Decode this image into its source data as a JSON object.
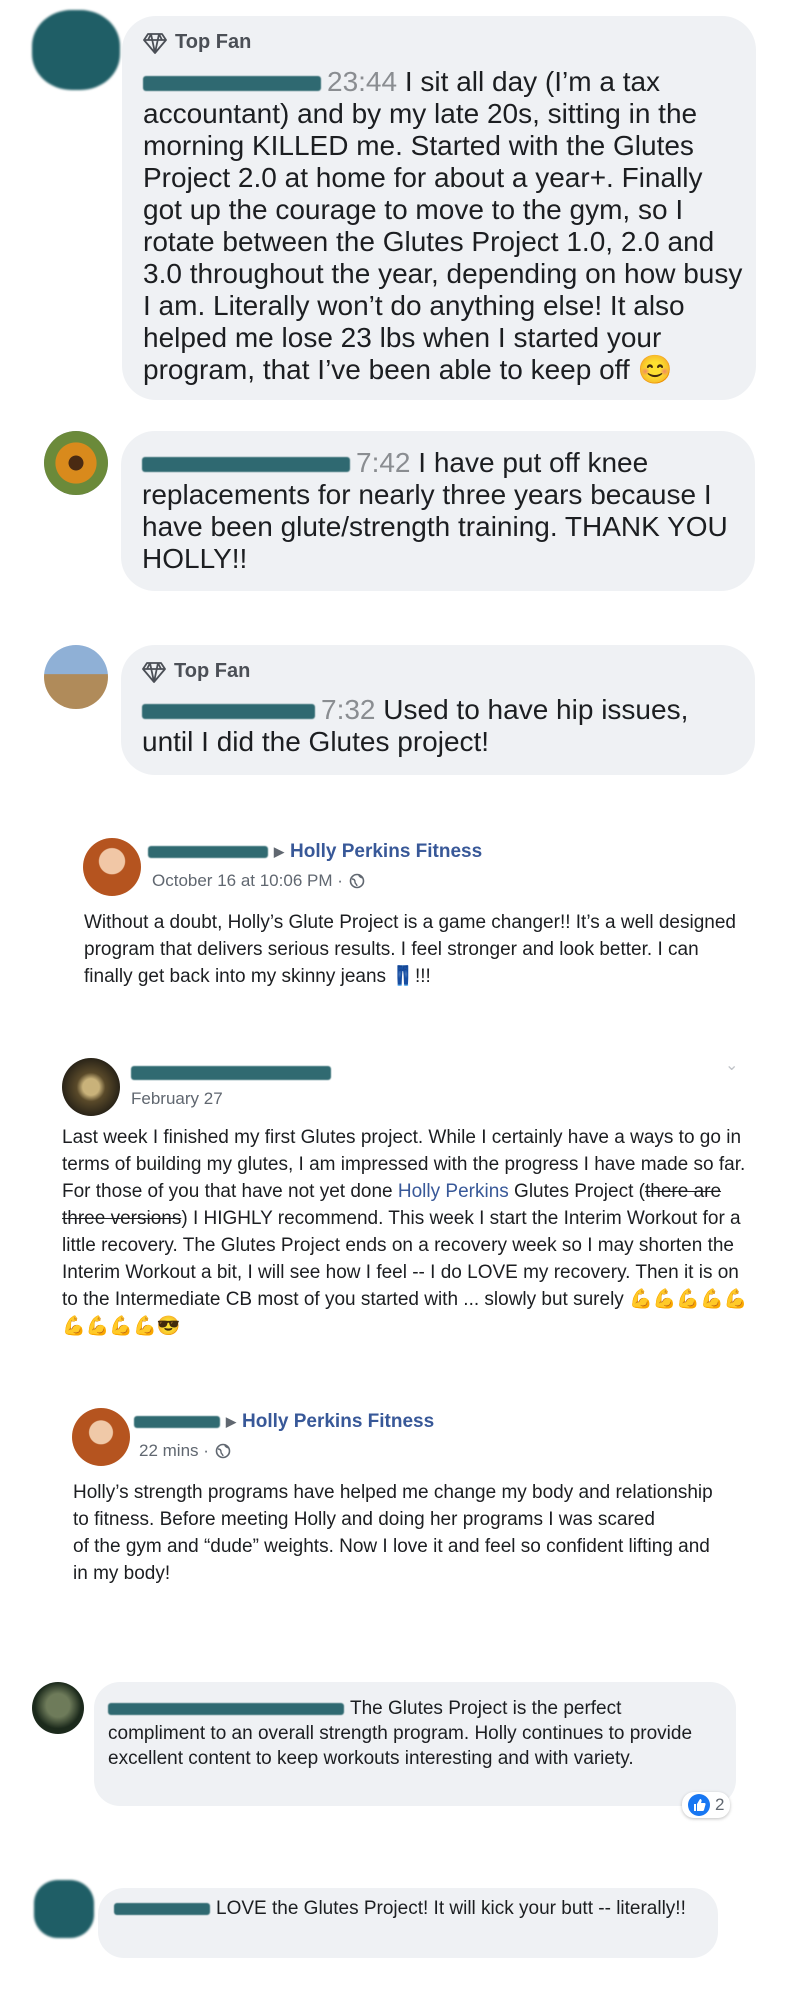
{
  "comment1": {
    "badge": "Top Fan",
    "time": "23:44",
    "text_before_emoji": "I sit all day (I’m a tax accountant) and by my late 20s, sitting in the morning KILLED me. Started with the Glutes Project 2.0 at home for about a year+. Finally got up the courage to move to the gym, so I rotate between the Glutes Project 1.0, 2.0 and 3.0 throughout the year, depending on how busy I am. Literally won’t do anything else! It also helped me lose 23 lbs when I started your program, that I’ve been able to keep off",
    "emoji": "😊"
  },
  "comment2": {
    "time": "7:42",
    "text": "I have put off knee replacements for nearly three years because I have been glute/strength training. THANK YOU HOLLY!!"
  },
  "comment3": {
    "badge": "Top Fan",
    "time": "7:32",
    "text": "Used to have hip issues, until I did the Glutes project!"
  },
  "post1": {
    "page_name": "Holly Perkins Fitness",
    "date": "October 16 at 10:06 PM ·",
    "text_before_emoji": "Without a doubt, Holly’s Glute Project is a game changer!! It’s a well designed program that delivers serious results. I feel stronger and look better. I can finally get back into my skinny jeans",
    "emoji": "👖",
    "text_after_emoji": "!!!"
  },
  "post2": {
    "date": "February 27",
    "text_1": "Last week I finished my first Glutes project. While I certainly have a ways to go in terms of building my glutes, I am impressed with the progress I have made so far. For those of you that have not yet done",
    "link": "Holly Perkins",
    "text_2": "Glutes Project (",
    "strike": "there are three versions",
    "text_3": ") I HIGHLY recommend. This week I start the Interim Workout for a little recovery. The Glutes Project ends on a recovery week so I may shorten the Interim Workout a bit, I will see how I feel -- I do LOVE my recovery. Then it is on to the Intermediate CB most of you started with ... slowly but surely",
    "emojis": "💪💪💪💪💪💪💪💪💪😎"
  },
  "post3": {
    "page_name": "Holly Perkins Fitness",
    "date": "22 mins ·",
    "text_1": "Holly’s strength programs have helped me change my body and relationship to fitness. Before meeting Holly and doing her programs I was scared",
    "text_2": "of the gym and “dude” weights. Now I love it and feel so confident lifting and in my body!"
  },
  "comment4": {
    "text": "The Glutes Project is the perfect compliment to an overall strength program. Holly continues to provide excellent content to keep workouts interesting and with variety.",
    "like_count": "2"
  },
  "comment5": {
    "text": "LOVE the Glutes Project! It will kick your butt -- literally!!"
  },
  "colors": {
    "bubble": "#eff1f4",
    "link": "#385898",
    "like": "#1877f2",
    "redaction": "#1f5e66"
  }
}
